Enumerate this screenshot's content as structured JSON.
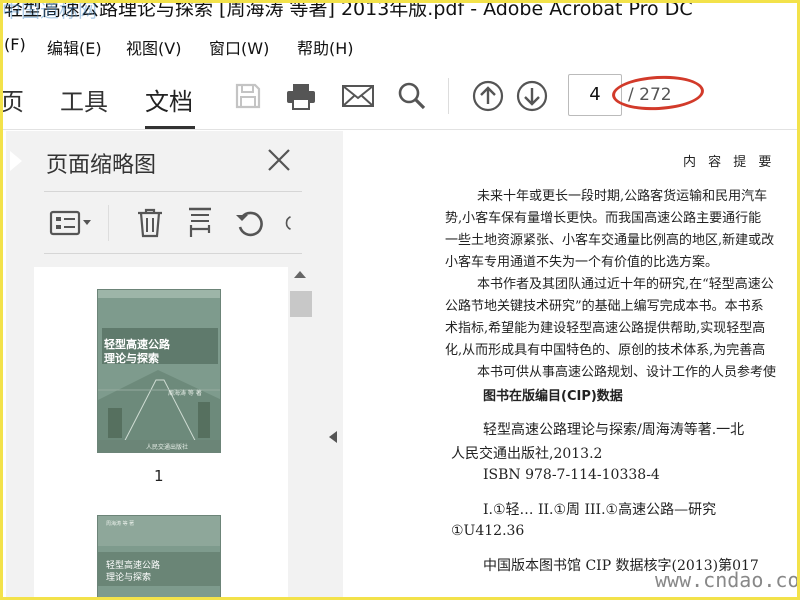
{
  "window": {
    "title": "轻型高速公路理论与探索 [周海涛 等著] 2013年版.pdf - Adobe Acrobat Pro DC",
    "watermark": "中国道标网"
  },
  "menu": {
    "items": [
      "(F)",
      "编辑(E)",
      "视图(V)",
      "窗口(W)",
      "帮助(H)"
    ]
  },
  "toolbar": {
    "tabs": [
      {
        "label": "页"
      },
      {
        "label": "工具"
      },
      {
        "label": "文档"
      }
    ],
    "active_tab": "文档",
    "icons": [
      "save-icon",
      "print-icon",
      "email-icon",
      "search-icon",
      "page-up-icon",
      "page-down-icon"
    ],
    "current_page": "4",
    "total_pages": "/ 272"
  },
  "sidepanel": {
    "title": "页面缩略图",
    "tools": [
      "thumbnail-options-icon",
      "delete-icon",
      "crop-icon",
      "rotate-ccw-icon",
      "rotate-cw-icon"
    ],
    "thumbnails": [
      {
        "label": "1",
        "cover_title": "轻型高速公路",
        "cover_subtitle": "理论与探索",
        "cover_author": "周海涛 等 著",
        "cover_publisher": "人民交通出版社"
      },
      {
        "label": "",
        "cover_title": "轻型高速公路",
        "cover_subtitle": "理论与探索",
        "cover_author": "周海涛 等 著"
      }
    ]
  },
  "document": {
    "heading": "内 容 提 要",
    "summary_lines": [
      "未来十年或更长一段时期,公路客货运输和民用汽车",
      "势,小客车保有量增长更快。而我国高速公路主要通行能",
      "一些土地资源紧张、小客车交通量比例高的地区,新建或改",
      "小客车专用通道不失为一个有价值的比选方案。",
      "本书作者及其团队通过近十年的研究,在“轻型高速公",
      "公路节地关键技术研究”的基础上编写完成本书。本书系",
      "术指标,希望能为建设轻型高速公路提供帮助,实现轻型高",
      "化,从而形成具有中国特色的、原创的技术体系,为完善高",
      "本书可供从事高速公路规划、设计工作的人员参考使"
    ],
    "cip_title": "图书在版编目(CIP)数据",
    "cip_lines": [
      "轻型高速公路理论与探索/周海涛等著.一北",
      "人民交通出版社,2013.2",
      "ISBN 978-7-114-10338-4",
      "I.①轻… II.①周 III.①高速公路—研究",
      "①U412.36",
      "中国版本图书馆 CIP 数据核字(2013)第017"
    ],
    "site_watermark": "www.cndao.com"
  }
}
